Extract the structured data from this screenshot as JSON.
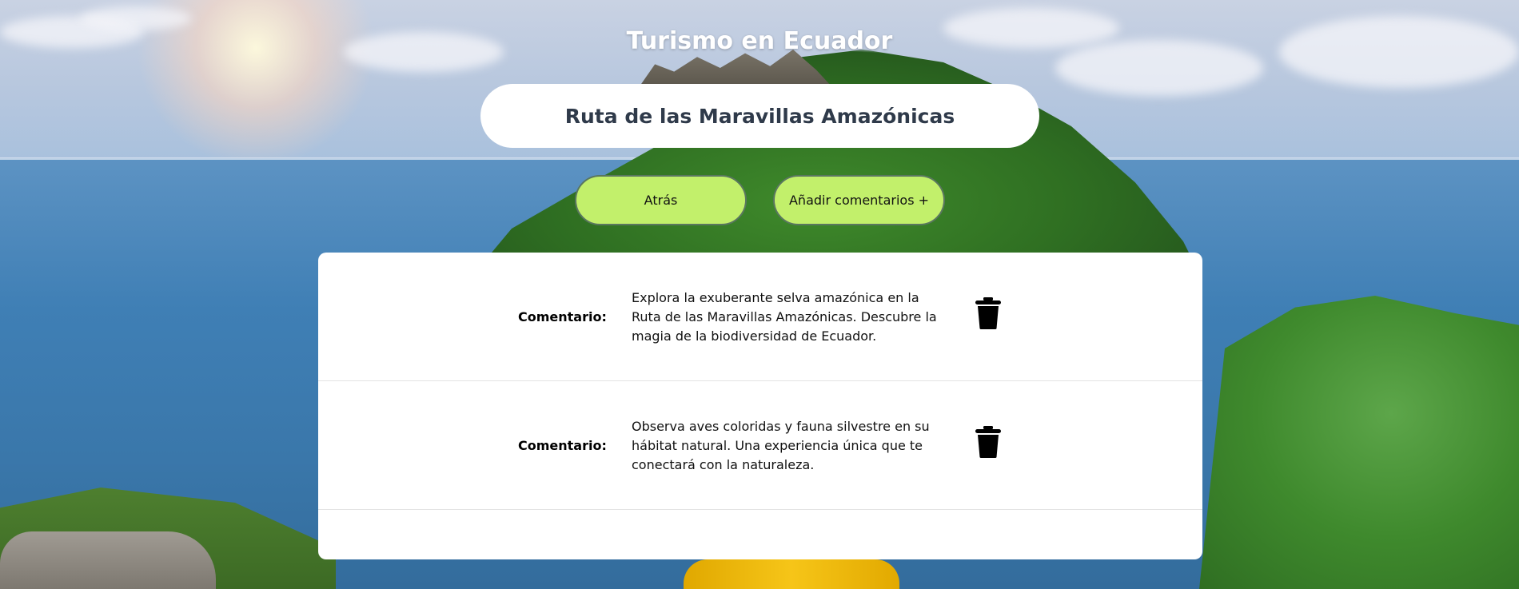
{
  "app": {
    "title": "Turismo en Ecuador"
  },
  "route": {
    "title": "Ruta de las Maravillas Amazónicas"
  },
  "actions": {
    "back_label": "Atrás",
    "add_comment_label": "Añadir comentarios +"
  },
  "comments": [
    {
      "label": "Comentario:",
      "text": "Explora la exuberante selva amazónica en la Ruta de las Maravillas Amazónicas. Descubre la magia de la biodiversidad de Ecuador.",
      "delete_icon": "trash-icon"
    },
    {
      "label": "Comentario:",
      "text": "Observa aves coloridas y fauna silvestre en su hábitat natural. Una experiencia única que te conectará con la naturaleza.",
      "delete_icon": "trash-icon"
    }
  ],
  "colors": {
    "button_bg": "#c2f06b",
    "button_border": "#5a7760",
    "title_text": "#2f3a4a",
    "panel_bg": "#ffffff"
  }
}
